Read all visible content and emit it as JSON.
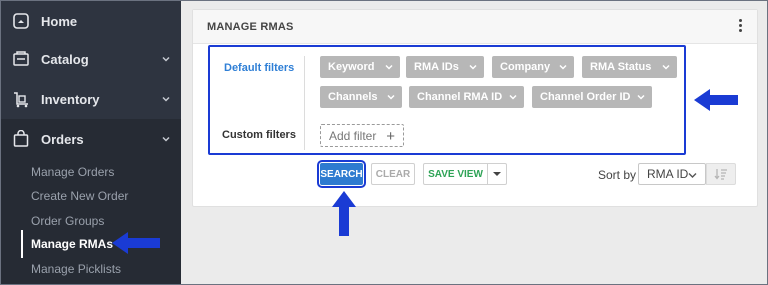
{
  "sidebar": {
    "items": [
      {
        "label": "Home",
        "icon": "home-icon"
      },
      {
        "label": "Catalog",
        "icon": "catalog-icon"
      },
      {
        "label": "Inventory",
        "icon": "inventory-icon"
      },
      {
        "label": "Orders",
        "icon": "shopping-bag-icon"
      }
    ],
    "orders_sub": [
      {
        "label": "Manage Orders"
      },
      {
        "label": "Create New Order"
      },
      {
        "label": "Order Groups"
      },
      {
        "label": "Manage RMAs"
      },
      {
        "label": "Manage Picklists"
      }
    ]
  },
  "card": {
    "title": "MANAGE RMAS",
    "default_filters_label": "Default filters",
    "custom_filters_label": "Custom filters",
    "filters": [
      {
        "label": "Keyword"
      },
      {
        "label": "RMA IDs"
      },
      {
        "label": "Company"
      },
      {
        "label": "RMA Status"
      },
      {
        "label": "Channels"
      },
      {
        "label": "Channel RMA ID"
      },
      {
        "label": "Channel Order ID"
      }
    ],
    "add_filter_label": "Add filter",
    "add_filter_plus": "+"
  },
  "actions": {
    "search_label": "SEARCH",
    "clear_label": "CLEAR",
    "save_view_label": "SAVE VIEW",
    "sort_by_label": "Sort by",
    "sort_value": "RMA ID"
  },
  "colors": {
    "sidebar_bg": "#2e3440",
    "accent_blue": "#2e7bd0",
    "annotation_blue": "#1a3bd4",
    "save_green": "#2ea356",
    "chip_gray": "#b7b7b7"
  }
}
